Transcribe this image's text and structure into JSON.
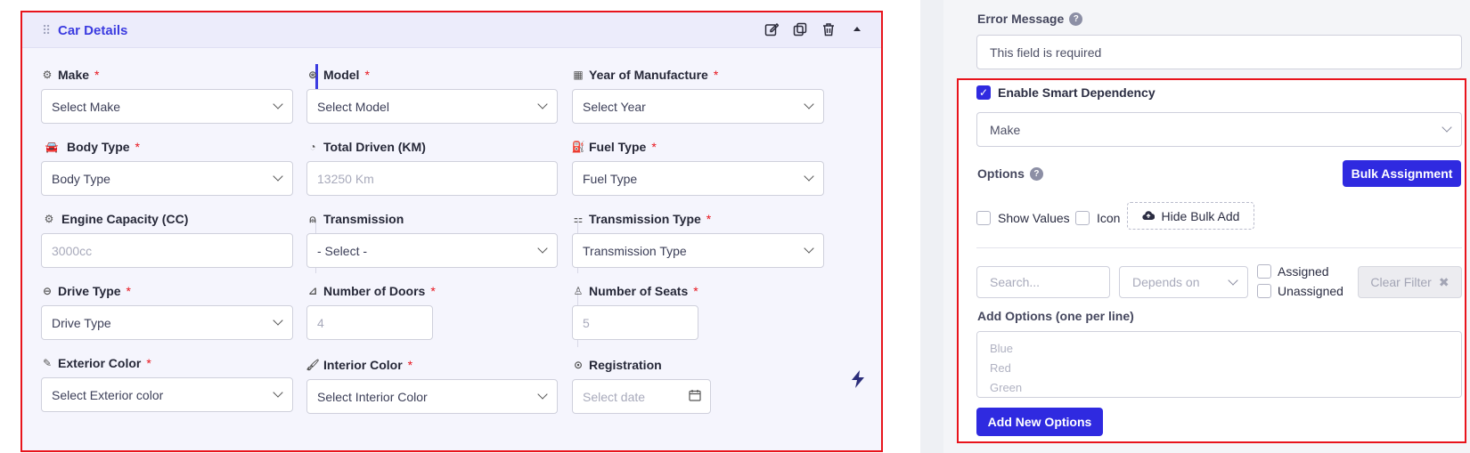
{
  "card": {
    "title": "Car Details",
    "header_icons": [
      "edit-icon",
      "duplicate-icon",
      "trash-icon",
      "collapse-caret-icon"
    ]
  },
  "fields": {
    "make": {
      "label": "Make",
      "required": "*",
      "value": "Select Make",
      "icon": "gear-icon"
    },
    "model": {
      "label": "Model",
      "required": "*",
      "value": "Select Model",
      "icon": "badge-icon"
    },
    "year": {
      "label": "Year of Manufacture",
      "required": "*",
      "value": "Select Year",
      "icon": "calendar-icon"
    },
    "body_type": {
      "label": "Body Type",
      "required": "*",
      "value": "Body Type",
      "icon": "car-icon"
    },
    "total_driven": {
      "label": "Total Driven (KM)",
      "placeholder": "13250 Km",
      "icon": "gauge-icon"
    },
    "fuel_type": {
      "label": "Fuel Type",
      "required": "*",
      "value": "Fuel Type",
      "icon": "fuel-pump-icon"
    },
    "engine": {
      "label": "Engine Capacity (CC)",
      "placeholder": "3000cc",
      "icon": "engine-icon"
    },
    "transmission": {
      "label": "Transmission",
      "value": "- Select -",
      "icon": "gearstick-icon"
    },
    "transmission_type": {
      "label": "Transmission Type",
      "required": "*",
      "value": "Transmission Type",
      "icon": "gearbox-icon"
    },
    "drive_type": {
      "label": "Drive Type",
      "required": "*",
      "value": "Drive Type",
      "icon": "steering-wheel-icon"
    },
    "doors": {
      "label": "Number of Doors",
      "required": "*",
      "placeholder": "4",
      "icon": "car-door-icon"
    },
    "seats": {
      "label": "Number of Seats",
      "required": "*",
      "placeholder": "5",
      "icon": "seat-icon"
    },
    "exterior_color": {
      "label": "Exterior Color",
      "required": "*",
      "value": "Select Exterior color",
      "icon": "paint-icon"
    },
    "interior_color": {
      "label": "Interior Color",
      "required": "*",
      "value": "Select Interior Color",
      "icon": "brush-icon"
    },
    "registration": {
      "label": "Registration",
      "placeholder": "Select date",
      "icon": "clock-icon"
    }
  },
  "settings": {
    "error_message_label": "Error Message",
    "error_message_value": "This field is required",
    "smart_dependency_label": "Enable Smart Dependency",
    "smart_dependency_checked": true,
    "dependency_select": "Make",
    "options_label": "Options",
    "bulk_assignment": "Bulk Assignment",
    "show_values": "Show Values",
    "icon_label": "Icon",
    "hide_bulk_add": "Hide Bulk Add",
    "search_placeholder": "Search...",
    "depends_on": "Depends on",
    "assigned": "Assigned",
    "unassigned": "Unassigned",
    "clear_filter": "Clear Filter",
    "add_options_label": "Add Options (one per line)",
    "add_options_placeholder": "Blue\nRed\nGreen",
    "add_new_options": "Add New Options"
  },
  "colors": {
    "accent": "#2f2ae0",
    "highlight": "#e8141c"
  }
}
